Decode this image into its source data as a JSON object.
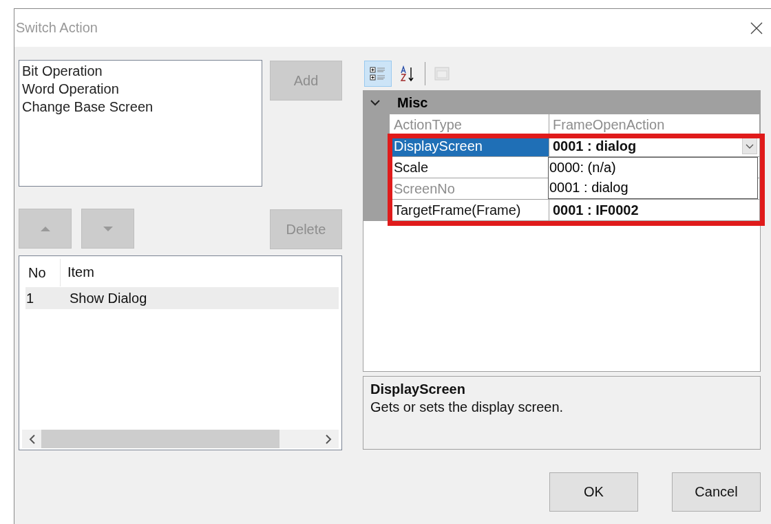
{
  "window": {
    "title": "Switch Action"
  },
  "available_actions": [
    {
      "label": "Bit Operation"
    },
    {
      "label": "Word Operation"
    },
    {
      "label": "Change Base Screen"
    }
  ],
  "add_button": {
    "label": "Add",
    "disabled": true
  },
  "move_buttons": [
    {
      "kind": "up",
      "disabled": true
    },
    {
      "kind": "down",
      "disabled": true
    }
  ],
  "delete_button": {
    "label": "Delete",
    "disabled": true
  },
  "action_list": {
    "columns": [
      "No",
      "Item"
    ],
    "rows": [
      {
        "cells": [
          "1",
          "Show Dialog"
        ],
        "selected": true
      }
    ]
  },
  "property_grid": {
    "toolbar": [
      {
        "kind": "categorized",
        "selected": true,
        "disabled": false
      },
      {
        "kind": "alphabetical",
        "selected": false,
        "disabled": false
      },
      {
        "kind": "pages",
        "selected": false,
        "disabled": true
      }
    ],
    "category": {
      "name": "Misc",
      "expanded": true,
      "properties": [
        {
          "name": "ActionType",
          "value": "FrameOpenAction",
          "readonly": true,
          "modified": false,
          "selected": false
        },
        {
          "name": "DisplayScreen",
          "value": "0001 : dialog",
          "readonly": false,
          "modified": true,
          "selected": true,
          "dropdown": {
            "options": [
              "0000: (n/a)",
              "0001 : dialog"
            ]
          }
        },
        {
          "name": "Scale",
          "readonly": false,
          "selected": false
        },
        {
          "name": "ScreenNo",
          "readonly": true,
          "selected": false
        },
        {
          "name": "TargetFrame(Frame)",
          "value": "0001 : IF0002",
          "readonly": false,
          "modified": true,
          "selected": false
        }
      ]
    }
  },
  "description": {
    "title": "DisplayScreen",
    "text": "Gets or sets the display screen."
  },
  "dialog_buttons": [
    "OK",
    "Cancel"
  ]
}
